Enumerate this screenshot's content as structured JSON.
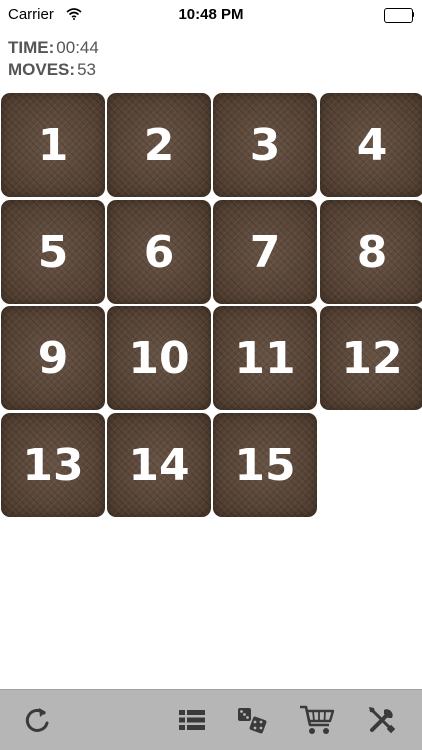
{
  "status_bar": {
    "carrier": "Carrier",
    "time": "10:48 PM",
    "wifi_icon": "wifi-icon",
    "battery_icon": "battery-icon"
  },
  "stats": {
    "time_label": "TIME:",
    "time_value": "00:44",
    "moves_label": "MOVES:",
    "moves_value": "53"
  },
  "board": {
    "tiles": [
      "1",
      "2",
      "3",
      "4",
      "5",
      "6",
      "7",
      "8",
      "9",
      "10",
      "11",
      "12",
      "13",
      "14",
      "15"
    ],
    "empty_slot": 16,
    "tile_color": "#5a4434"
  },
  "toolbar": {
    "icons": [
      "restart-icon",
      "list-icon",
      "dice-icon",
      "cart-icon",
      "settings-icon"
    ],
    "background": "#b6b6b6",
    "icon_color": "#3a3a3a"
  }
}
